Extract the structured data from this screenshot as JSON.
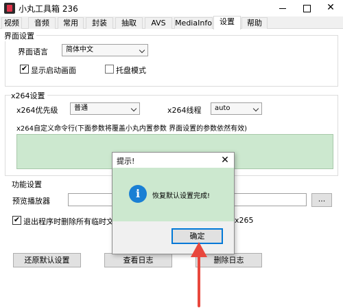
{
  "window": {
    "title": "小丸工具箱 236",
    "close_glyph": "✕"
  },
  "tabs": [
    {
      "label": "视频"
    },
    {
      "label": "音频"
    },
    {
      "label": "常用"
    },
    {
      "label": "封装"
    },
    {
      "label": "抽取"
    },
    {
      "label": "AVS"
    },
    {
      "label": "MediaInfo"
    },
    {
      "label": "设置",
      "active": true
    },
    {
      "label": "帮助"
    }
  ],
  "ui_settings": {
    "group_title": "界面设置",
    "language_label": "界面语言",
    "language_value": "简体中文",
    "show_splash_label": "显示启动画面",
    "show_splash_checked": true,
    "tray_mode_label": "托盘模式",
    "tray_mode_checked": false
  },
  "x264_settings": {
    "group_title": "x264设置",
    "priority_label": "x264优先级",
    "priority_value": "普通",
    "threads_label": "x264线程",
    "threads_value": "auto",
    "custom_cmd_label": "x264自定义命令行(下面参数将覆盖小丸内置参数 界面设置的参数依然有效)",
    "custom_cmd_value": ""
  },
  "features": {
    "group_title": "功能设置",
    "preview_player_label": "预览播放器",
    "preview_player_value": "",
    "browse_label": "...",
    "delete_temp_label": "退出程序时删除所有临时文件",
    "delete_temp_checked": true,
    "tail_text": "x265"
  },
  "buttons": {
    "restore_defaults": "还原默认设置",
    "view_log": "查看日志",
    "delete_log": "删除日志"
  },
  "dialog": {
    "title": "提示!",
    "close_glyph": "✕",
    "icon": "info-icon",
    "icon_glyph": "i",
    "message": "恢复默认设置完成!",
    "ok_label": "确定"
  },
  "colors": {
    "highlight_green": "#cce8cf",
    "arrow_red": "#e8473d",
    "focus_blue": "#0078d7"
  }
}
